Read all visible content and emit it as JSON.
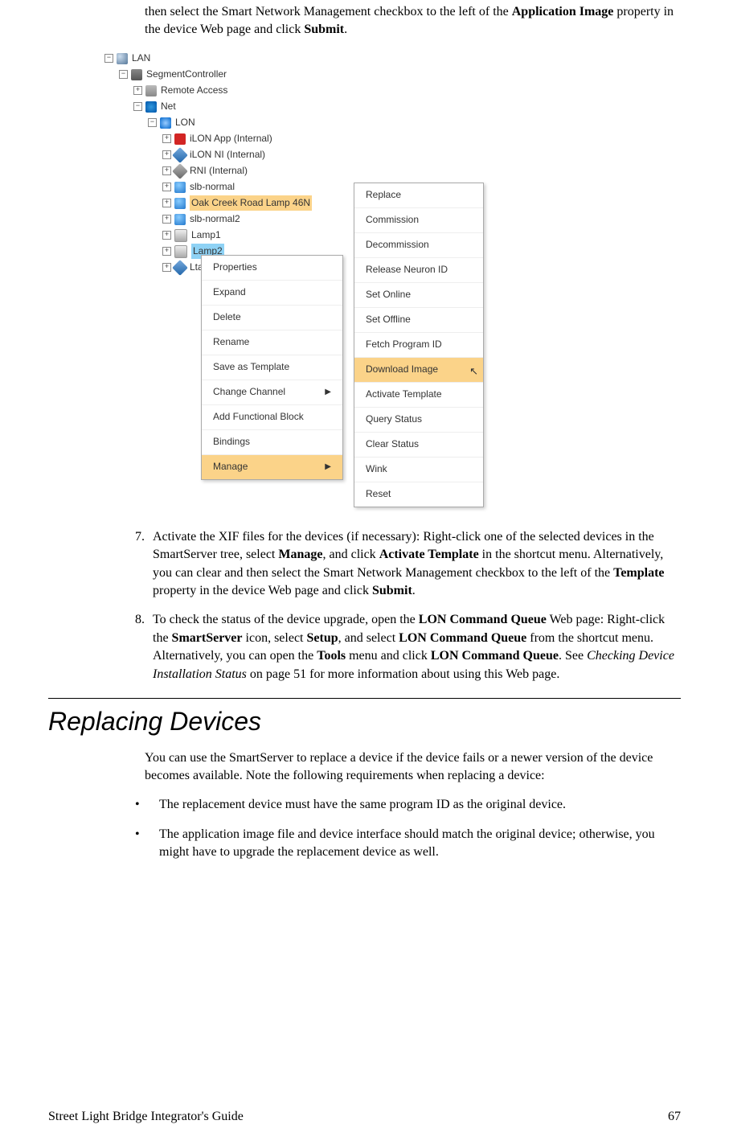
{
  "intro": {
    "line1": "then select the Smart Network Management checkbox to the left of the ",
    "bold1": "Application Image",
    "line2": " property in the device Web page and click ",
    "bold2": "Submit",
    "line3": "."
  },
  "tree": {
    "n0": "LAN",
    "n1": "SegmentController",
    "n2": "Remote Access",
    "n3": "Net",
    "n4": "LON",
    "n5": "iLON App (Internal)",
    "n6": "iLON NI (Internal)",
    "n7": "RNI (Internal)",
    "n8": "slb-normal",
    "n9": "Oak Creek Road Lamp 46N",
    "n10": "slb-normal2",
    "n11": "Lamp1",
    "n12": "Lamp2",
    "n13": "LtaL"
  },
  "menu1": {
    "i0": "Properties",
    "i1": "Expand",
    "i2": "Delete",
    "i3": "Rename",
    "i4": "Save as Template",
    "i5": "Change Channel",
    "i6": "Add Functional Block",
    "i7": "Bindings",
    "i8": "Manage"
  },
  "menu2": {
    "i0": "Replace",
    "i1": "Commission",
    "i2": "Decommission",
    "i3": "Release Neuron ID",
    "i4": "Set Online",
    "i5": "Set Offline",
    "i6": "Fetch Program ID",
    "i7": "Download Image",
    "i8": "Activate Template",
    "i9": "Query Status",
    "i10": "Clear Status",
    "i11": "Wink",
    "i12": "Reset"
  },
  "step7": {
    "num": "7.",
    "a": "Activate the XIF files for the devices (if necessary):  Right-click one of the selected devices in the SmartServer tree, select ",
    "b1": "Manage",
    "c": ", and click ",
    "b2": "Activate Template",
    "d": " in the shortcut menu.  Alternatively, you can clear and then select the Smart Network Management checkbox to the left of the ",
    "b3": "Template",
    "e": " property in the device Web page and click ",
    "b4": "Submit",
    "f": "."
  },
  "step8": {
    "num": "8.",
    "a": "To check the status of the device upgrade, open the ",
    "b1": "LON Command Queue",
    "c": " Web page:  Right-click the ",
    "b2": "SmartServer",
    "d": " icon, select ",
    "b3": "Setup",
    "e": ", and select ",
    "b4": "LON Command Queue",
    "f": " from the shortcut menu.  Alternatively, you can open the ",
    "b5": "Tools",
    "g": " menu and click ",
    "b6": "LON Command Queue",
    "h": ".  See ",
    "i1": "Checking Device Installation Status",
    "i2": " on page 51 for more information about using this Web page."
  },
  "section": {
    "title": "Replacing Devices",
    "intro": "You can use the SmartServer to replace a device if the device fails or a newer version of the device becomes available.  Note the following requirements when replacing a device:",
    "bul1": "The replacement device must have the same program ID as the original device.",
    "bul2": "The application image file and device interface should match the original device; otherwise, you might have to upgrade the replacement device as well."
  },
  "footer": {
    "left": "Street Light Bridge Integrator's Guide",
    "right": "67"
  }
}
